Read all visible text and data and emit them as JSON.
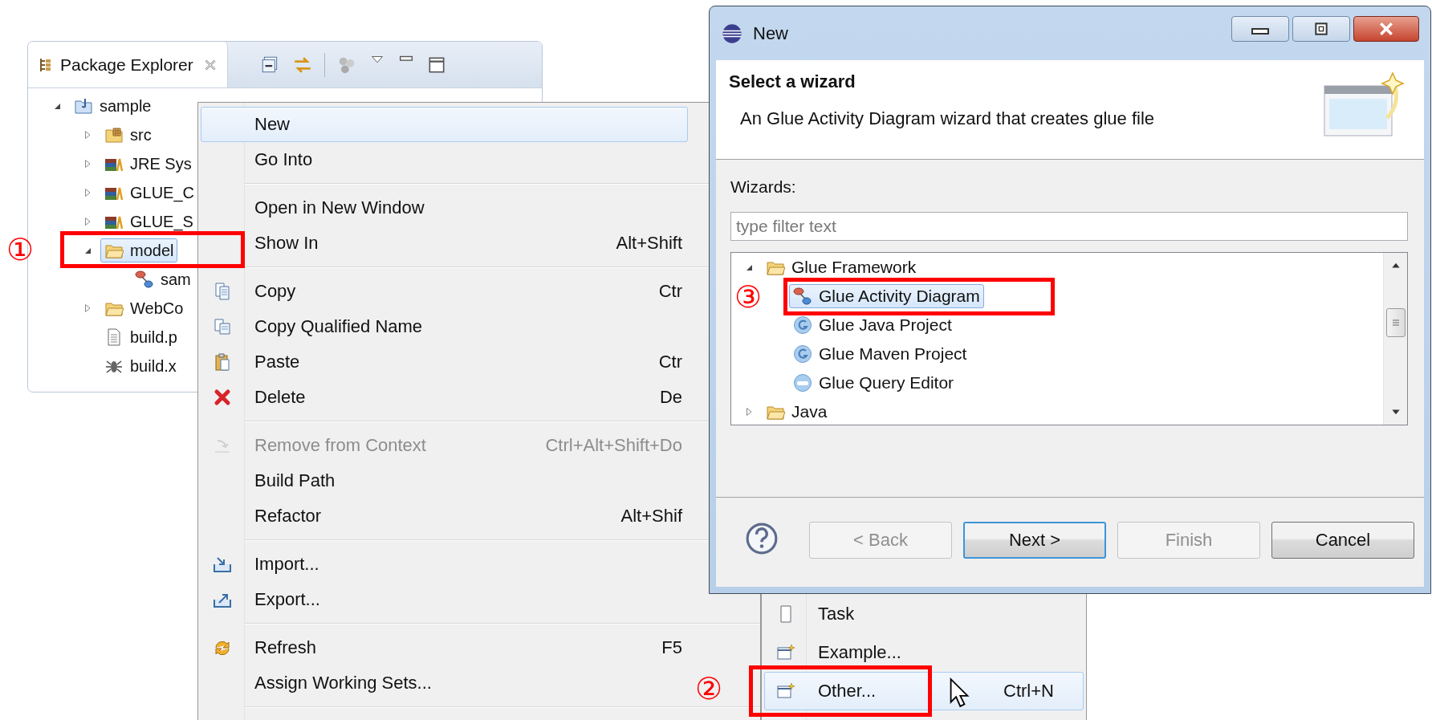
{
  "explorer": {
    "tab": {
      "title": "Package Explorer"
    },
    "tree": [
      {
        "label": "sample",
        "kind": "project",
        "expanded": true,
        "selected": false,
        "children": [
          {
            "label": "src",
            "kind": "source",
            "expanded": false,
            "selected": false
          },
          {
            "label": "JRE Sys",
            "kind": "library",
            "expanded": false,
            "selected": false
          },
          {
            "label": "GLUE_C",
            "kind": "library",
            "expanded": false,
            "selected": false
          },
          {
            "label": "GLUE_S",
            "kind": "library",
            "expanded": false,
            "selected": false
          },
          {
            "label": "model",
            "kind": "folder",
            "expanded": true,
            "selected": true,
            "children": [
              {
                "label": "sam",
                "kind": "diagram",
                "selected": false
              }
            ]
          },
          {
            "label": "WebCo",
            "kind": "folder",
            "expanded": false,
            "selected": false
          },
          {
            "label": "build.p",
            "kind": "file",
            "selected": false
          },
          {
            "label": "build.x",
            "kind": "ant",
            "selected": false
          }
        ]
      }
    ]
  },
  "context_menu": {
    "items": [
      {
        "kind": "item",
        "label": "New",
        "selected": true,
        "disabled": false
      },
      {
        "kind": "item",
        "label": "Go Into",
        "selected": false,
        "disabled": false
      },
      {
        "kind": "separator"
      },
      {
        "kind": "item",
        "label": "Open in New Window",
        "selected": false,
        "disabled": false
      },
      {
        "kind": "item",
        "label": "Show In",
        "shortcut": "Alt+Shift",
        "selected": false,
        "disabled": false
      },
      {
        "kind": "separator"
      },
      {
        "kind": "item",
        "label": "Copy",
        "shortcut": "Ctr",
        "selected": false,
        "disabled": false
      },
      {
        "kind": "item",
        "label": "Copy Qualified Name",
        "selected": false,
        "disabled": false
      },
      {
        "kind": "item",
        "label": "Paste",
        "shortcut": "Ctr",
        "selected": false,
        "disabled": false
      },
      {
        "kind": "item",
        "label": "Delete",
        "shortcut": "De",
        "selected": false,
        "disabled": false
      },
      {
        "kind": "separator"
      },
      {
        "kind": "item",
        "label": "Remove from Context",
        "shortcut": "Ctrl+Alt+Shift+Do",
        "selected": false,
        "disabled": true
      },
      {
        "kind": "item",
        "label": "Build Path",
        "selected": false,
        "disabled": false
      },
      {
        "kind": "item",
        "label": "Refactor",
        "shortcut": "Alt+Shif",
        "selected": false,
        "disabled": false
      },
      {
        "kind": "separator"
      },
      {
        "kind": "item",
        "label": "Import...",
        "selected": false,
        "disabled": false
      },
      {
        "kind": "item",
        "label": "Export...",
        "selected": false,
        "disabled": false
      },
      {
        "kind": "separator"
      },
      {
        "kind": "item",
        "label": "Refresh",
        "shortcut": "F5",
        "selected": false,
        "disabled": false
      },
      {
        "kind": "item",
        "label": "Assign Working Sets...",
        "selected": false,
        "disabled": false
      },
      {
        "kind": "separator"
      }
    ]
  },
  "submenu": {
    "items": [
      {
        "label": "Task",
        "selected": false
      },
      {
        "label": "Example...",
        "selected": false
      },
      {
        "label": "Other...",
        "shortcut": "Ctrl+N",
        "selected": true
      }
    ]
  },
  "dialog": {
    "title": "New",
    "header": {
      "title": "Select a wizard",
      "description": "An Glue Activity Diagram wizard that creates glue file"
    },
    "wizards_label": "Wizards:",
    "filter": {
      "placeholder": "type filter text"
    },
    "tree": [
      {
        "label": "Glue Framework",
        "kind": "folder",
        "expanded": true,
        "selected": false,
        "children": [
          {
            "label": "Glue Activity Diagram",
            "kind": "diagram",
            "selected": true
          },
          {
            "label": "Glue Java Project",
            "kind": "glue",
            "selected": false
          },
          {
            "label": "Glue Maven Project",
            "kind": "glue",
            "selected": false
          },
          {
            "label": "Glue Query Editor",
            "kind": "sql",
            "selected": false
          }
        ]
      },
      {
        "label": "Java",
        "kind": "folder",
        "expanded": false,
        "selected": false
      }
    ],
    "buttons": [
      {
        "label": "< Back",
        "disabled": true,
        "default": false
      },
      {
        "label": "Next >",
        "disabled": false,
        "default": true
      },
      {
        "label": "Finish",
        "disabled": true,
        "default": false
      },
      {
        "label": "Cancel",
        "disabled": false,
        "default": false
      }
    ]
  },
  "annotations": [
    {
      "number": "①"
    },
    {
      "number": "②"
    },
    {
      "number": "③"
    }
  ]
}
